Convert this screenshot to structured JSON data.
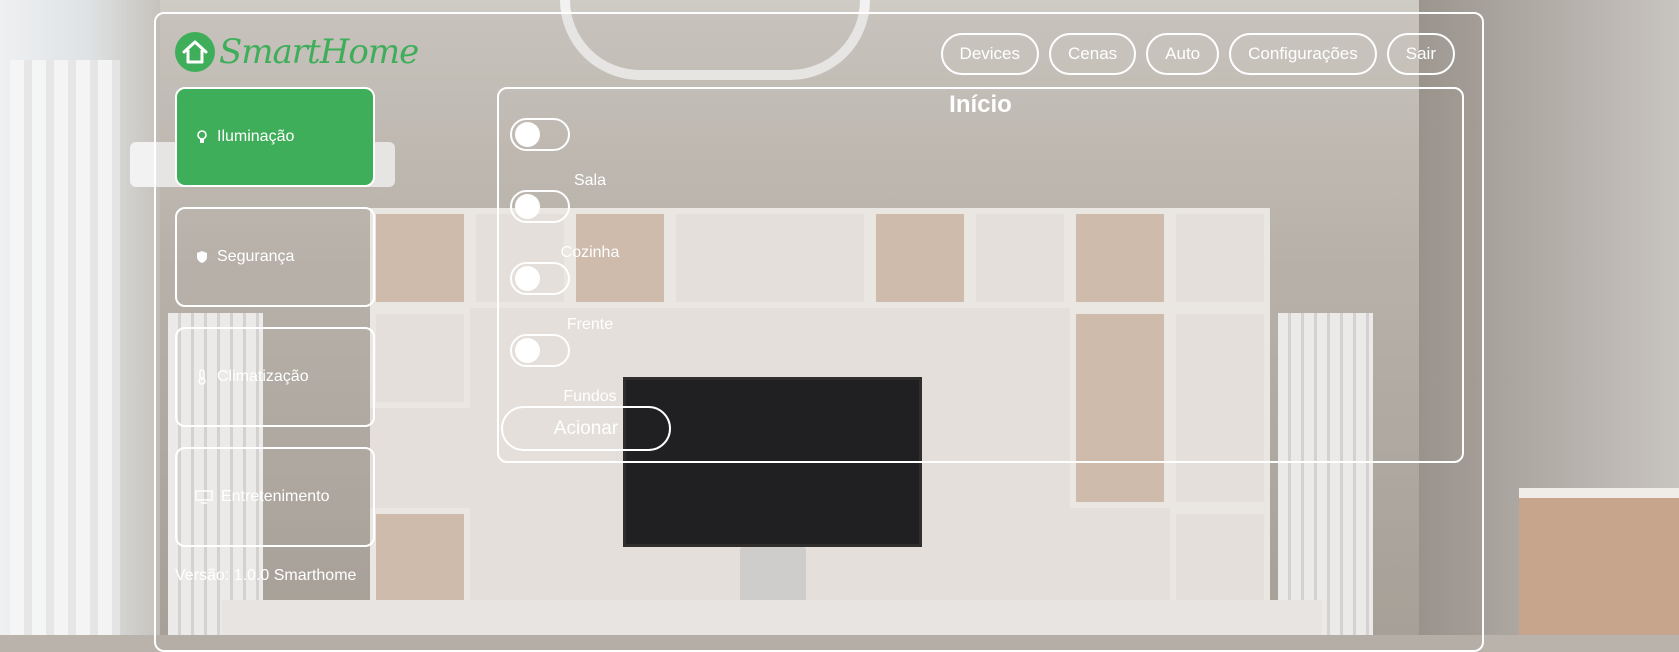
{
  "app": {
    "logo_text": "SmartHome"
  },
  "topnav": {
    "items": [
      {
        "label": "Devices"
      },
      {
        "label": "Cenas"
      },
      {
        "label": "Auto"
      },
      {
        "label": "Configurações"
      },
      {
        "label": "Sair"
      }
    ]
  },
  "sidebar": {
    "items": [
      {
        "label": "Iluminação",
        "icon": "lightbulb-icon",
        "active": true
      },
      {
        "label": "Segurança",
        "icon": "shield-icon",
        "active": false
      },
      {
        "label": "Climatização",
        "icon": "thermometer-icon",
        "active": false
      },
      {
        "label": "Entretenimento",
        "icon": "monitor-icon",
        "active": false
      }
    ],
    "version": "Versão: 1.0.0 Smarthome"
  },
  "panel": {
    "title": "Início",
    "rooms": [
      {
        "label": "Sala",
        "on": false
      },
      {
        "label": "Cozinha",
        "on": false
      },
      {
        "label": "Frente",
        "on": false
      },
      {
        "label": "Fundos",
        "on": false
      }
    ],
    "action_label": "Acionar"
  },
  "colors": {
    "accent": "#3fae5a",
    "border": "#ffffff"
  }
}
